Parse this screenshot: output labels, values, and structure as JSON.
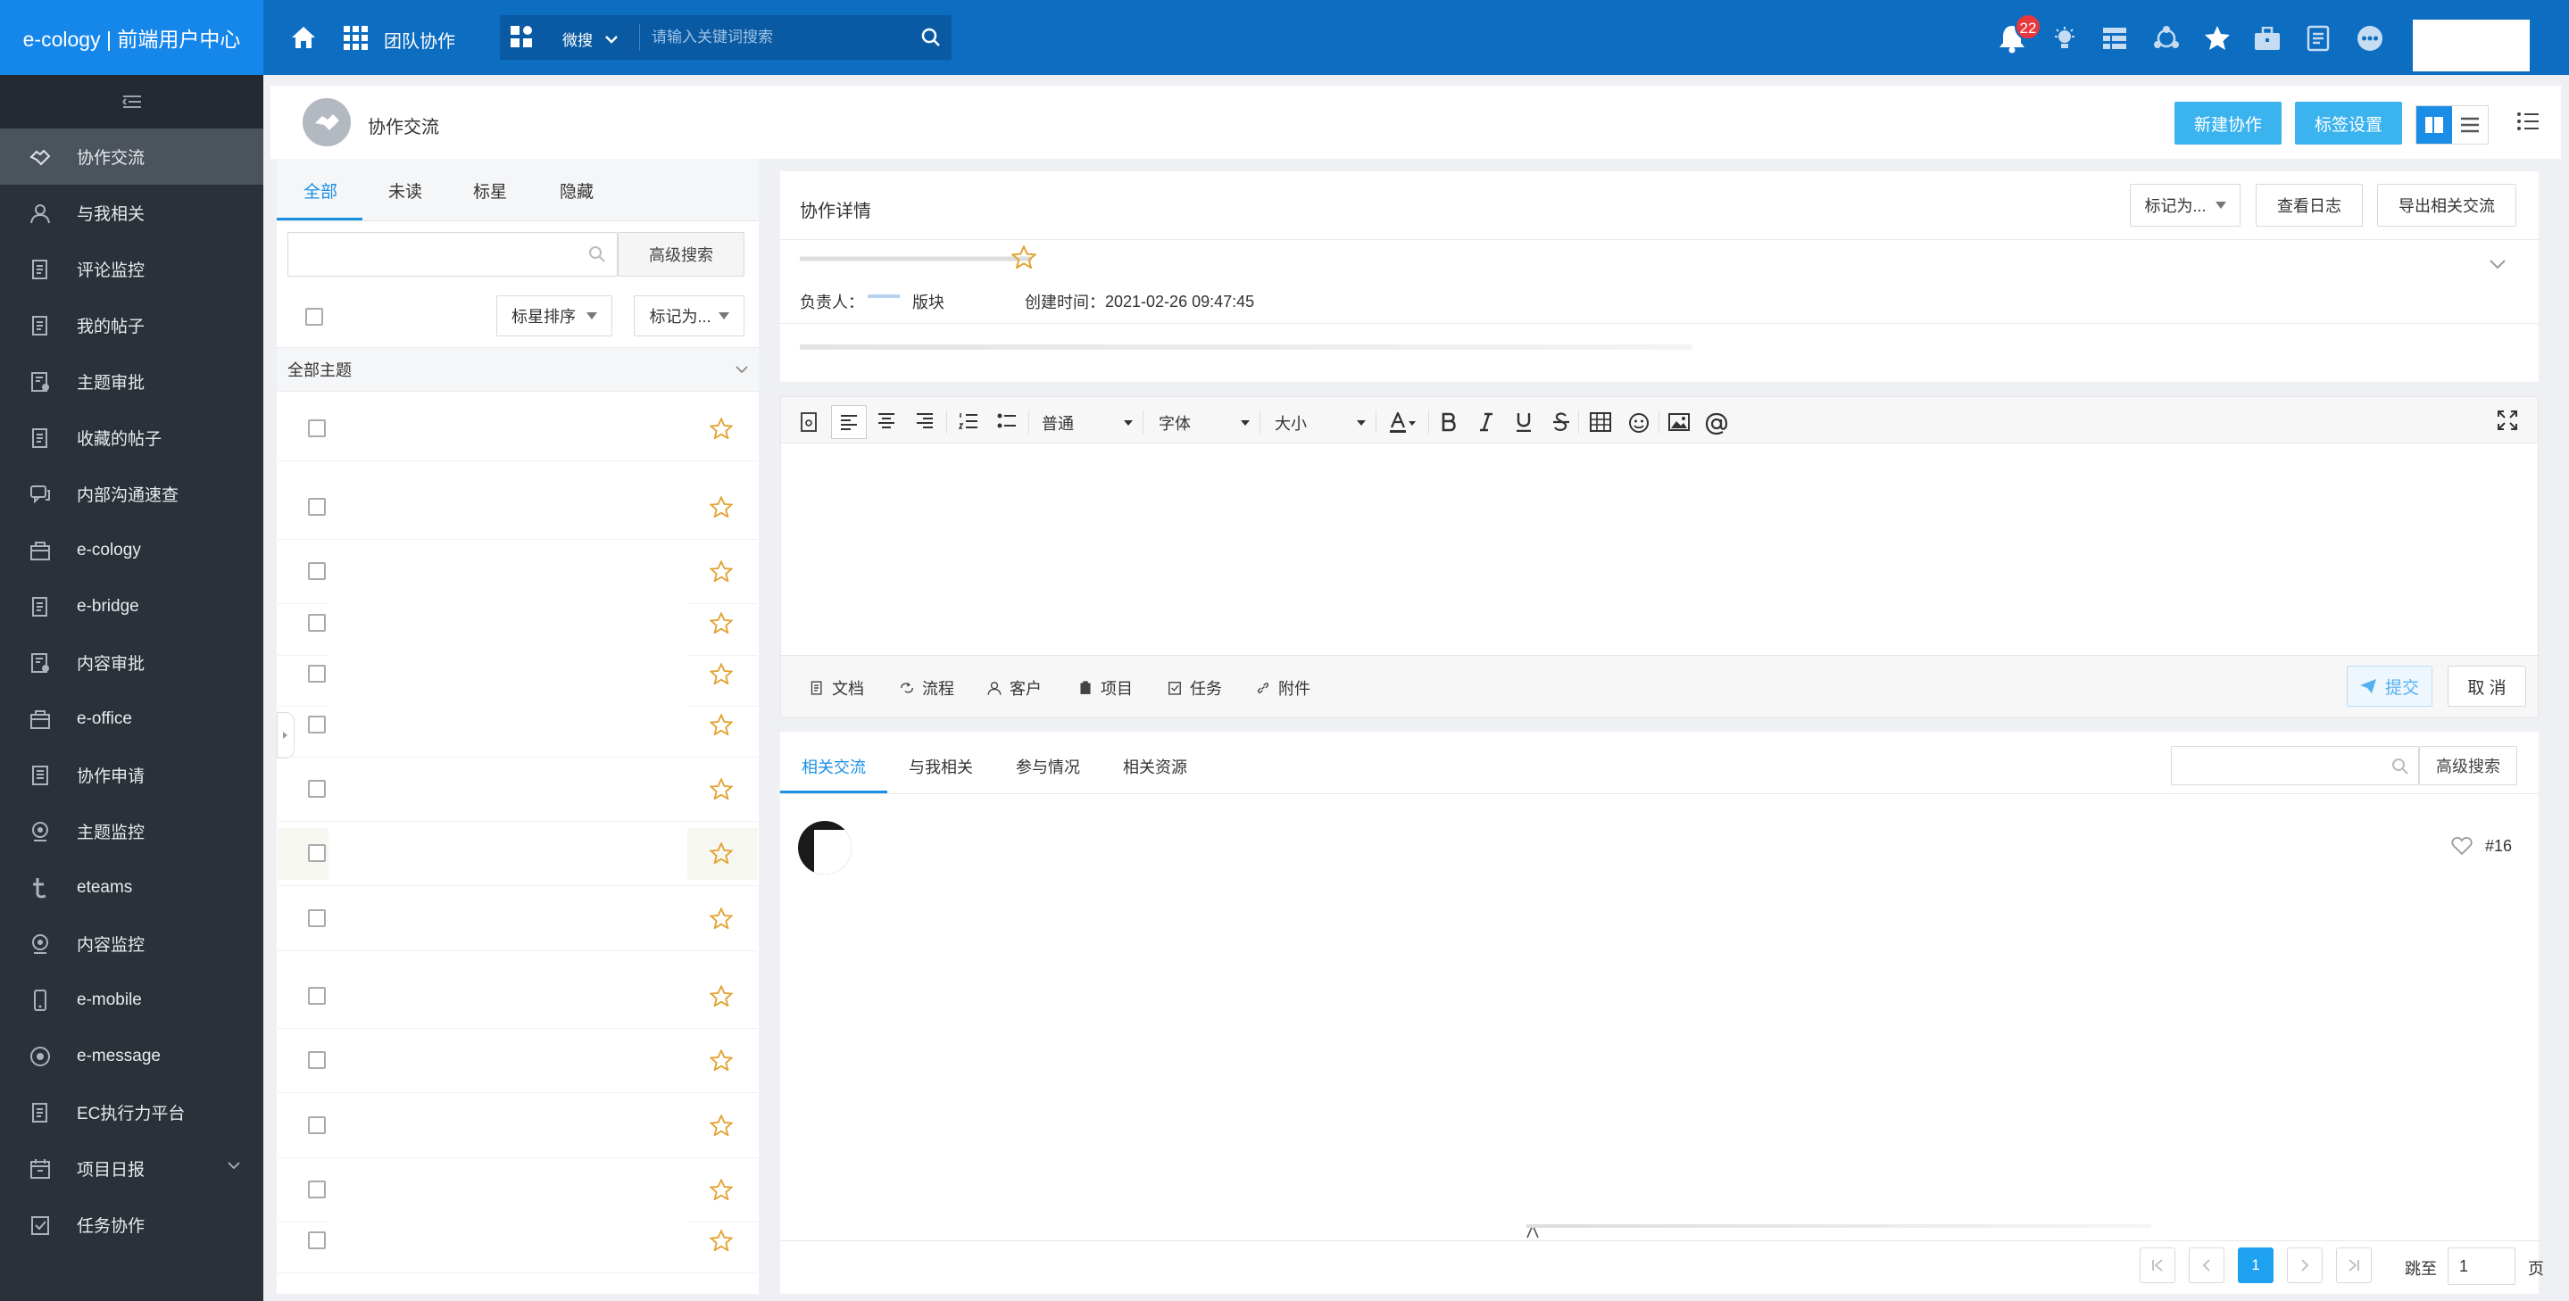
{
  "header": {
    "brand": "e-cology | 前端用户中心",
    "module": "团队协作",
    "search_scope": "微搜",
    "search_placeholder": "请输入关键词搜索",
    "notification_count": "22",
    "colors": {
      "header_bg": "#0d6dc1",
      "brand_bg": "#1586ea",
      "badge": "#e8383d"
    },
    "right_icons": [
      "bell-icon",
      "bulb-icon",
      "grid-icon",
      "share-icon",
      "star-icon",
      "briefcase-icon",
      "doc-icon",
      "more-icon"
    ]
  },
  "sidebar": {
    "items": [
      {
        "label": "协作交流",
        "icon": "handshake-icon",
        "active": true
      },
      {
        "label": "与我相关",
        "icon": "user-icon"
      },
      {
        "label": "评论监控",
        "icon": "doc-icon"
      },
      {
        "label": "我的帖子",
        "icon": "doc-icon"
      },
      {
        "label": "主题审批",
        "icon": "approve-icon"
      },
      {
        "label": "收藏的帖子",
        "icon": "doc-icon"
      },
      {
        "label": "内部沟通速查",
        "icon": "chat-icon"
      },
      {
        "label": "e-cology",
        "icon": "box-icon"
      },
      {
        "label": "e-bridge",
        "icon": "doc-icon"
      },
      {
        "label": "内容审批",
        "icon": "approve-icon"
      },
      {
        "label": "e-office",
        "icon": "box-icon"
      },
      {
        "label": "协作申请",
        "icon": "form-icon"
      },
      {
        "label": "主题监控",
        "icon": "monitor-icon"
      },
      {
        "label": "eteams",
        "icon": "t-icon"
      },
      {
        "label": "内容监控",
        "icon": "monitor-icon"
      },
      {
        "label": "e-mobile",
        "icon": "phone-icon"
      },
      {
        "label": "e-message",
        "icon": "eye-icon"
      },
      {
        "label": "EC执行力平台",
        "icon": "doc-icon"
      },
      {
        "label": "项目日报",
        "icon": "calendar-icon",
        "has_children": true
      },
      {
        "label": "任务协作",
        "icon": "task-icon"
      }
    ]
  },
  "page": {
    "title": "协作交流",
    "new_button": "新建协作",
    "tag_button": "标签设置"
  },
  "list_panel": {
    "tabs": [
      "全部",
      "未读",
      "标星",
      "隐藏"
    ],
    "advanced_search": "高级搜索",
    "sort_label": "标星排序",
    "mark_label": "标记为...",
    "group_label": "全部主题",
    "row_count": 14
  },
  "detail": {
    "title": "协作详情",
    "mark_label": "标记为...",
    "log_button": "查看日志",
    "export_button": "导出相关交流",
    "owner_label": "负责人：",
    "block_label": "版块",
    "created_label": "创建时间：",
    "created_value": "2021-02-26 09:47:45"
  },
  "editor": {
    "para_select": "普通",
    "font_select": "字体",
    "size_select": "大小",
    "attachments": [
      {
        "label": "文档",
        "icon": "doc-icon"
      },
      {
        "label": "流程",
        "icon": "flow-icon"
      },
      {
        "label": "客户",
        "icon": "user-icon"
      },
      {
        "label": "项目",
        "icon": "project-icon"
      },
      {
        "label": "任务",
        "icon": "task-icon"
      },
      {
        "label": "附件",
        "icon": "link-icon"
      }
    ],
    "submit_label": "提交",
    "cancel_label": "取 消"
  },
  "comments": {
    "tabs": [
      "相关交流",
      "与我相关",
      "参与情况",
      "相关资源"
    ],
    "advanced_search": "高级搜索",
    "floor": "#16"
  },
  "pagination": {
    "current": "1",
    "jump_label": "跳至",
    "jump_value": "1",
    "page_unit": "页"
  }
}
